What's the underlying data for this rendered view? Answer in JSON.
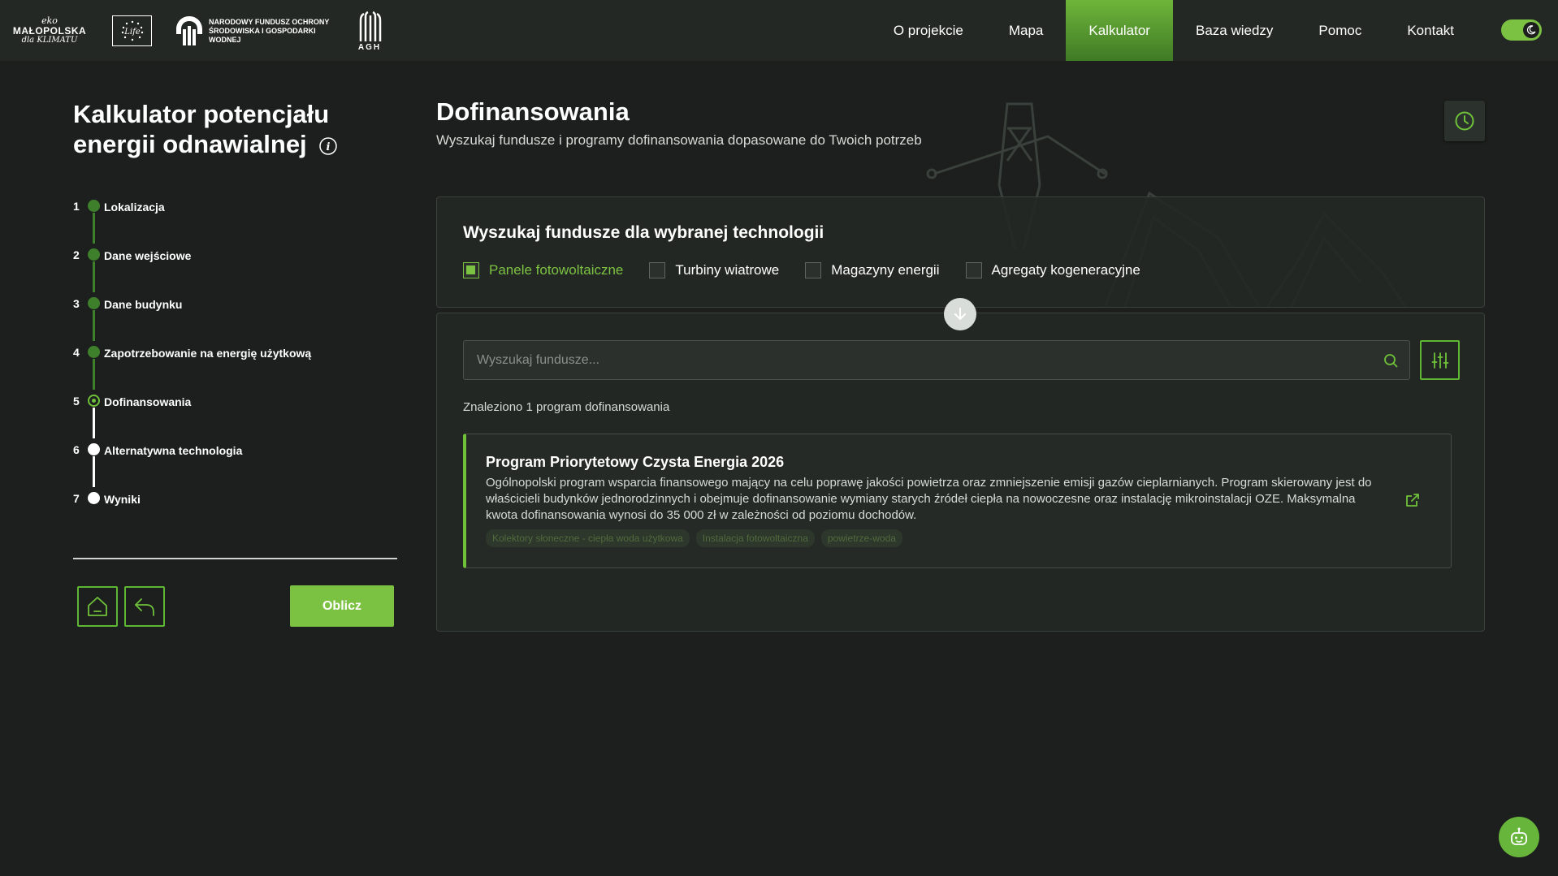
{
  "header": {
    "logo_malopolska": {
      "top": "eko",
      "name": "MAŁOPOLSKA",
      "sub": "dla KLIMATU"
    },
    "logo_life": "Life",
    "logo_nfosigw": "NARODOWY FUNDUSZ OCHRONY ŚRODOWISKA I GOSPODARKI WODNEJ",
    "logo_agh": "AGH",
    "nav": [
      {
        "label": "O projekcie",
        "active": false
      },
      {
        "label": "Mapa",
        "active": false
      },
      {
        "label": "Kalkulator",
        "active": true
      },
      {
        "label": "Baza wiedzy",
        "active": false
      },
      {
        "label": "Pomoc",
        "active": false
      },
      {
        "label": "Kontakt",
        "active": false
      }
    ],
    "theme_toggle_icon": "moon-icon"
  },
  "sidebar": {
    "title": "Kalkulator potencjału energii odnawialnej",
    "steps": [
      {
        "num": "1",
        "label": "Lokalizacja",
        "state": "done"
      },
      {
        "num": "2",
        "label": "Dane wejściowe",
        "state": "done"
      },
      {
        "num": "3",
        "label": "Dane budynku",
        "state": "done"
      },
      {
        "num": "4",
        "label": "Zapotrzebowanie na energię użytkową",
        "state": "done"
      },
      {
        "num": "5",
        "label": "Dofinansowania",
        "state": "current"
      },
      {
        "num": "6",
        "label": "Alternatywna technologia",
        "state": "future"
      },
      {
        "num": "7",
        "label": "Wyniki",
        "state": "future"
      }
    ],
    "calculate_label": "Oblicz"
  },
  "main": {
    "title": "Dofinansowania",
    "subtitle": "Wyszukaj fundusze i programy dofinansowania dopasowane do Twoich potrzeb",
    "tech_section": {
      "heading": "Wyszukaj fundusze dla wybranej technologii",
      "options": [
        {
          "label": "Panele fotowoltaiczne",
          "checked": true
        },
        {
          "label": "Turbiny wiatrowe",
          "checked": false
        },
        {
          "label": "Magazyny energii",
          "checked": false
        },
        {
          "label": "Agregaty kogeneracyjne",
          "checked": false
        }
      ]
    },
    "search": {
      "placeholder": "Wyszukaj fundusze..."
    },
    "found_text": "Znaleziono 1 program dofinansowania",
    "programs": [
      {
        "title": "Program Priorytetowy Czysta Energia 2026",
        "description": "Ogólnopolski program wsparcia finansowego mający na celu poprawę jakości powietrza oraz zmniejszenie emisji gazów cieplarnianych. Program skierowany jest do właścicieli budynków jednorodzinnych i obejmuje dofinansowanie wymiany starych źródeł ciepła na nowoczesne oraz instalację mikroinstalacji OZE. Maksymalna kwota dofinansowania wynosi do 35 000 zł w zależności od poziomu dochodów.",
        "tags": [
          "Kolektory słoneczne - ciepła woda użytkowa",
          "Instalacja fotowoltaiczna",
          "powietrze-woda"
        ]
      }
    ]
  },
  "colors": {
    "accent": "#7cc242",
    "background": "#1c1f1d",
    "header": "#232824"
  }
}
